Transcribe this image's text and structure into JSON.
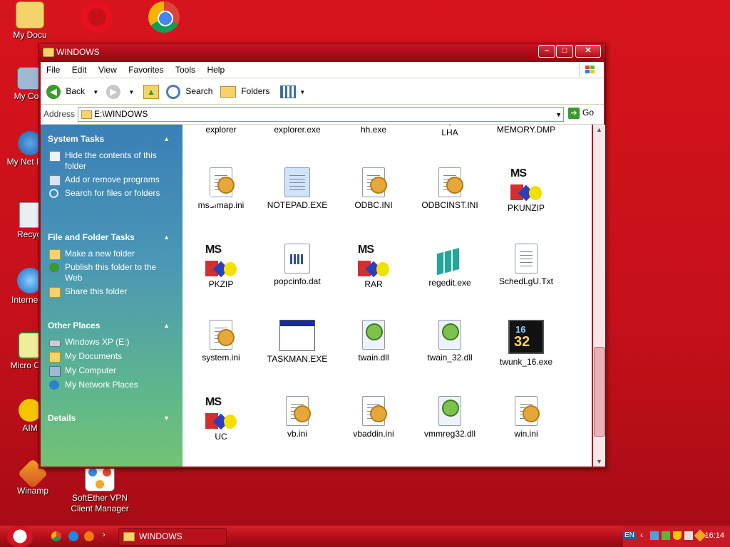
{
  "desktop": {
    "icons": [
      {
        "label": "My Docu"
      },
      {
        "label": "My Com"
      },
      {
        "label": "My Net Plac"
      },
      {
        "label": "Recycl"
      },
      {
        "label": "Internet E"
      },
      {
        "label": "Micro Outl"
      },
      {
        "label": "AIM"
      },
      {
        "label": "Winamp"
      },
      {
        "label": "SoftEther VPN Client Manager"
      }
    ]
  },
  "window": {
    "title": "WINDOWS",
    "minimize": "–",
    "maximize": "□",
    "close": "✕",
    "menu": [
      "File",
      "Edit",
      "View",
      "Favorites",
      "Tools",
      "Help"
    ],
    "toolbar": {
      "back": "Back",
      "search": "Search",
      "folders": "Folders"
    },
    "address": {
      "label": "Address",
      "value": "E:\\WINDOWS",
      "go": "Go"
    }
  },
  "taskpane": {
    "system_tasks": {
      "title": "System Tasks",
      "items": [
        "Hide the contents of this folder",
        "Add or remove programs",
        "Search for files or folders"
      ]
    },
    "file_folder_tasks": {
      "title": "File and Folder Tasks",
      "items": [
        "Make a new folder",
        "Publish this folder to the Web",
        "Share this folder"
      ]
    },
    "other_places": {
      "title": "Other Places",
      "items": [
        "Windows XP (E:)",
        "My Documents",
        "My Computer",
        "My Network Places"
      ]
    },
    "details": {
      "title": "Details"
    }
  },
  "files": [
    {
      "name": "explorer",
      "icon": "app-icon"
    },
    {
      "name": "explorer.exe",
      "icon": "app-icon"
    },
    {
      "name": "hh.exe",
      "icon": "app-icon"
    },
    {
      "name": "LHA",
      "icon": "msdos-icon"
    },
    {
      "name": "MEMORY.DMP",
      "icon": "file-icon"
    },
    {
      "name": "msdfmap.ini",
      "icon": "ini-icon"
    },
    {
      "name": "NOTEPAD.EXE",
      "icon": "notepad-icon"
    },
    {
      "name": "ODBC.INI",
      "icon": "ini-icon"
    },
    {
      "name": "ODBCINST.INI",
      "icon": "ini-icon"
    },
    {
      "name": "PKUNZIP",
      "icon": "msdos-icon"
    },
    {
      "name": "PKZIP",
      "icon": "msdos-icon"
    },
    {
      "name": "popcinfo.dat",
      "icon": "dat-icon"
    },
    {
      "name": "RAR",
      "icon": "msdos-icon"
    },
    {
      "name": "regedit.exe",
      "icon": "regedit-icon"
    },
    {
      "name": "SchedLgU.Txt",
      "icon": "txt-icon"
    },
    {
      "name": "system.ini",
      "icon": "ini-icon"
    },
    {
      "name": "TASKMAN.EXE",
      "icon": "window-icon"
    },
    {
      "name": "twain.dll",
      "icon": "dll-icon"
    },
    {
      "name": "twain_32.dll",
      "icon": "dll-icon"
    },
    {
      "name": "twunk_16.exe",
      "icon": "twunk-icon"
    },
    {
      "name": "UC",
      "icon": "msdos-icon"
    },
    {
      "name": "vb.ini",
      "icon": "ini-icon"
    },
    {
      "name": "vbaddin.ini",
      "icon": "ini-icon"
    },
    {
      "name": "vmmreg32.dll",
      "icon": "dll-icon"
    },
    {
      "name": "win.ini",
      "icon": "ini-icon"
    }
  ],
  "taskbar": {
    "task": "WINDOWS",
    "language": "EN",
    "clock": "16:14"
  },
  "colors": {
    "desktop": "#c4101a",
    "taskpane_top": "#3a7fb7",
    "taskpane_bottom": "#74c274",
    "titlebar": "#b00d18"
  }
}
